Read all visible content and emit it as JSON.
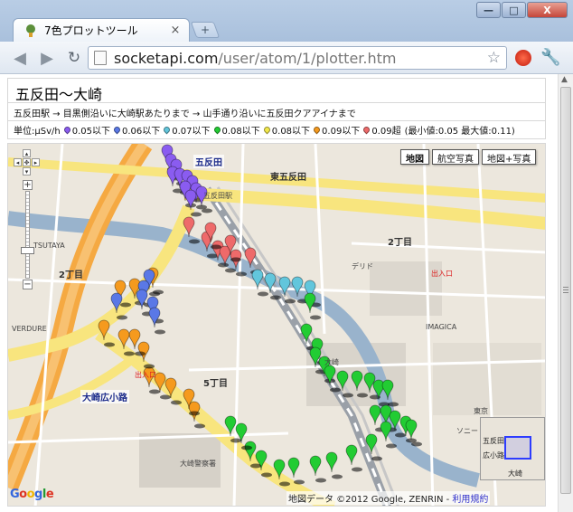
{
  "browser": {
    "tab_title": "7色プロットツール",
    "tab_close": "×",
    "new_tab": "+",
    "window_controls": {
      "minimize": "—",
      "maximize": "□",
      "close": "X"
    },
    "url_host": "socketapi.com",
    "url_path": "/user/atom/1/plotter.htm",
    "icons": [
      "back-arrow-icon",
      "forward-arrow-icon",
      "reload-icon",
      "page-icon",
      "star-icon",
      "extension-icon",
      "wrench-icon"
    ]
  },
  "page": {
    "title": "五反田～大崎",
    "route": "五反田駅 → 目黒側沿いに大崎駅あたりまで → 山手通り沿いに五反田クアアイナまで",
    "legend": {
      "unit_label": "単位:μSv/h",
      "items": [
        {
          "label": "0.05以下",
          "color": "#8a5cf0"
        },
        {
          "label": "0.06以下",
          "color": "#5a78e6"
        },
        {
          "label": "0.07以下",
          "color": "#62c6dc"
        },
        {
          "label": "0.08以下",
          "color": "#22cc33"
        },
        {
          "label": "0.08以下",
          "color": "#f2e84a"
        },
        {
          "label": "0.09以下",
          "color": "#f59a1e"
        },
        {
          "label": "0.09超",
          "color": "#ee6a6a"
        }
      ],
      "stats": "(最小値:0.05 最大値:0.11)"
    }
  },
  "map": {
    "type_buttons": [
      "地図",
      "航空写真",
      "地図+写真"
    ],
    "active_type": "地図",
    "copyright_prefix": "地図データ ©2012 Google, ZENRIN - ",
    "terms_link": "利用規約",
    "google_logo": "Google",
    "zoom_plus": "+",
    "zoom_minus": "−",
    "labels": [
      {
        "text": "五反田",
        "cls": "station"
      },
      {
        "text": "東五反田",
        "cls": "district"
      },
      {
        "text": "2丁目",
        "cls": "district"
      },
      {
        "text": "2丁目",
        "cls": "district"
      },
      {
        "text": "5丁目",
        "cls": "district"
      },
      {
        "text": "大崎広小路",
        "cls": "station"
      },
      {
        "text": "五反田駅",
        "cls": "small"
      },
      {
        "text": "TSUTAYA",
        "cls": "small"
      },
      {
        "text": "VERDURE",
        "cls": "small"
      },
      {
        "text": "東京",
        "cls": "small"
      },
      {
        "text": "IMAGICA",
        "cls": "small"
      },
      {
        "text": "デリド",
        "cls": "small"
      },
      {
        "text": "出入口",
        "cls": "red"
      },
      {
        "text": "出入口",
        "cls": "red"
      },
      {
        "text": "大崎警察署",
        "cls": "small"
      },
      {
        "text": "ソニー",
        "cls": "small"
      },
      {
        "text": "大崎",
        "cls": "small"
      }
    ],
    "overview_labels": [
      "五反田",
      "大崎",
      "広小路"
    ],
    "markers": [
      {
        "c": "#8a5cf0"
      },
      {
        "c": "#8a5cf0"
      },
      {
        "c": "#8a5cf0"
      },
      {
        "c": "#8a5cf0"
      },
      {
        "c": "#8a5cf0"
      },
      {
        "c": "#8a5cf0"
      },
      {
        "c": "#8a5cf0"
      },
      {
        "c": "#8a5cf0"
      },
      {
        "c": "#8a5cf0"
      },
      {
        "c": "#8a5cf0"
      },
      {
        "c": "#8a5cf0"
      },
      {
        "c": "#ee6a6a"
      },
      {
        "c": "#ee6a6a"
      },
      {
        "c": "#ee6a6a"
      },
      {
        "c": "#ee6a6a"
      },
      {
        "c": "#ee6a6a"
      },
      {
        "c": "#ee6a6a"
      },
      {
        "c": "#ee6a6a"
      },
      {
        "c": "#ee6a6a"
      },
      {
        "c": "#62c6dc"
      },
      {
        "c": "#62c6dc"
      },
      {
        "c": "#62c6dc"
      },
      {
        "c": "#62c6dc"
      },
      {
        "c": "#62c6dc"
      },
      {
        "c": "#22cc33"
      },
      {
        "c": "#22cc33"
      },
      {
        "c": "#22cc33"
      },
      {
        "c": "#22cc33"
      },
      {
        "c": "#22cc33"
      },
      {
        "c": "#22cc33"
      },
      {
        "c": "#22cc33"
      },
      {
        "c": "#22cc33"
      },
      {
        "c": "#22cc33"
      },
      {
        "c": "#22cc33"
      },
      {
        "c": "#22cc33"
      },
      {
        "c": "#22cc33"
      },
      {
        "c": "#22cc33"
      },
      {
        "c": "#22cc33"
      },
      {
        "c": "#22cc33"
      },
      {
        "c": "#22cc33"
      },
      {
        "c": "#22cc33"
      },
      {
        "c": "#22cc33"
      },
      {
        "c": "#22cc33"
      },
      {
        "c": "#22cc33"
      },
      {
        "c": "#22cc33"
      },
      {
        "c": "#22cc33"
      },
      {
        "c": "#22cc33"
      },
      {
        "c": "#22cc33"
      },
      {
        "c": "#22cc33"
      },
      {
        "c": "#22cc33"
      },
      {
        "c": "#22cc33"
      },
      {
        "c": "#f59a1e"
      },
      {
        "c": "#f59a1e"
      },
      {
        "c": "#f59a1e"
      },
      {
        "c": "#f59a1e"
      },
      {
        "c": "#f59a1e"
      },
      {
        "c": "#f59a1e"
      },
      {
        "c": "#f59a1e"
      },
      {
        "c": "#f59a1e"
      },
      {
        "c": "#f59a1e"
      },
      {
        "c": "#f59a1e"
      },
      {
        "c": "#f59a1e"
      },
      {
        "c": "#f59a1e"
      },
      {
        "c": "#5a78e6"
      },
      {
        "c": "#5a78e6"
      },
      {
        "c": "#5a78e6"
      },
      {
        "c": "#5a78e6"
      },
      {
        "c": "#5a78e6"
      },
      {
        "c": "#5a78e6"
      }
    ]
  }
}
